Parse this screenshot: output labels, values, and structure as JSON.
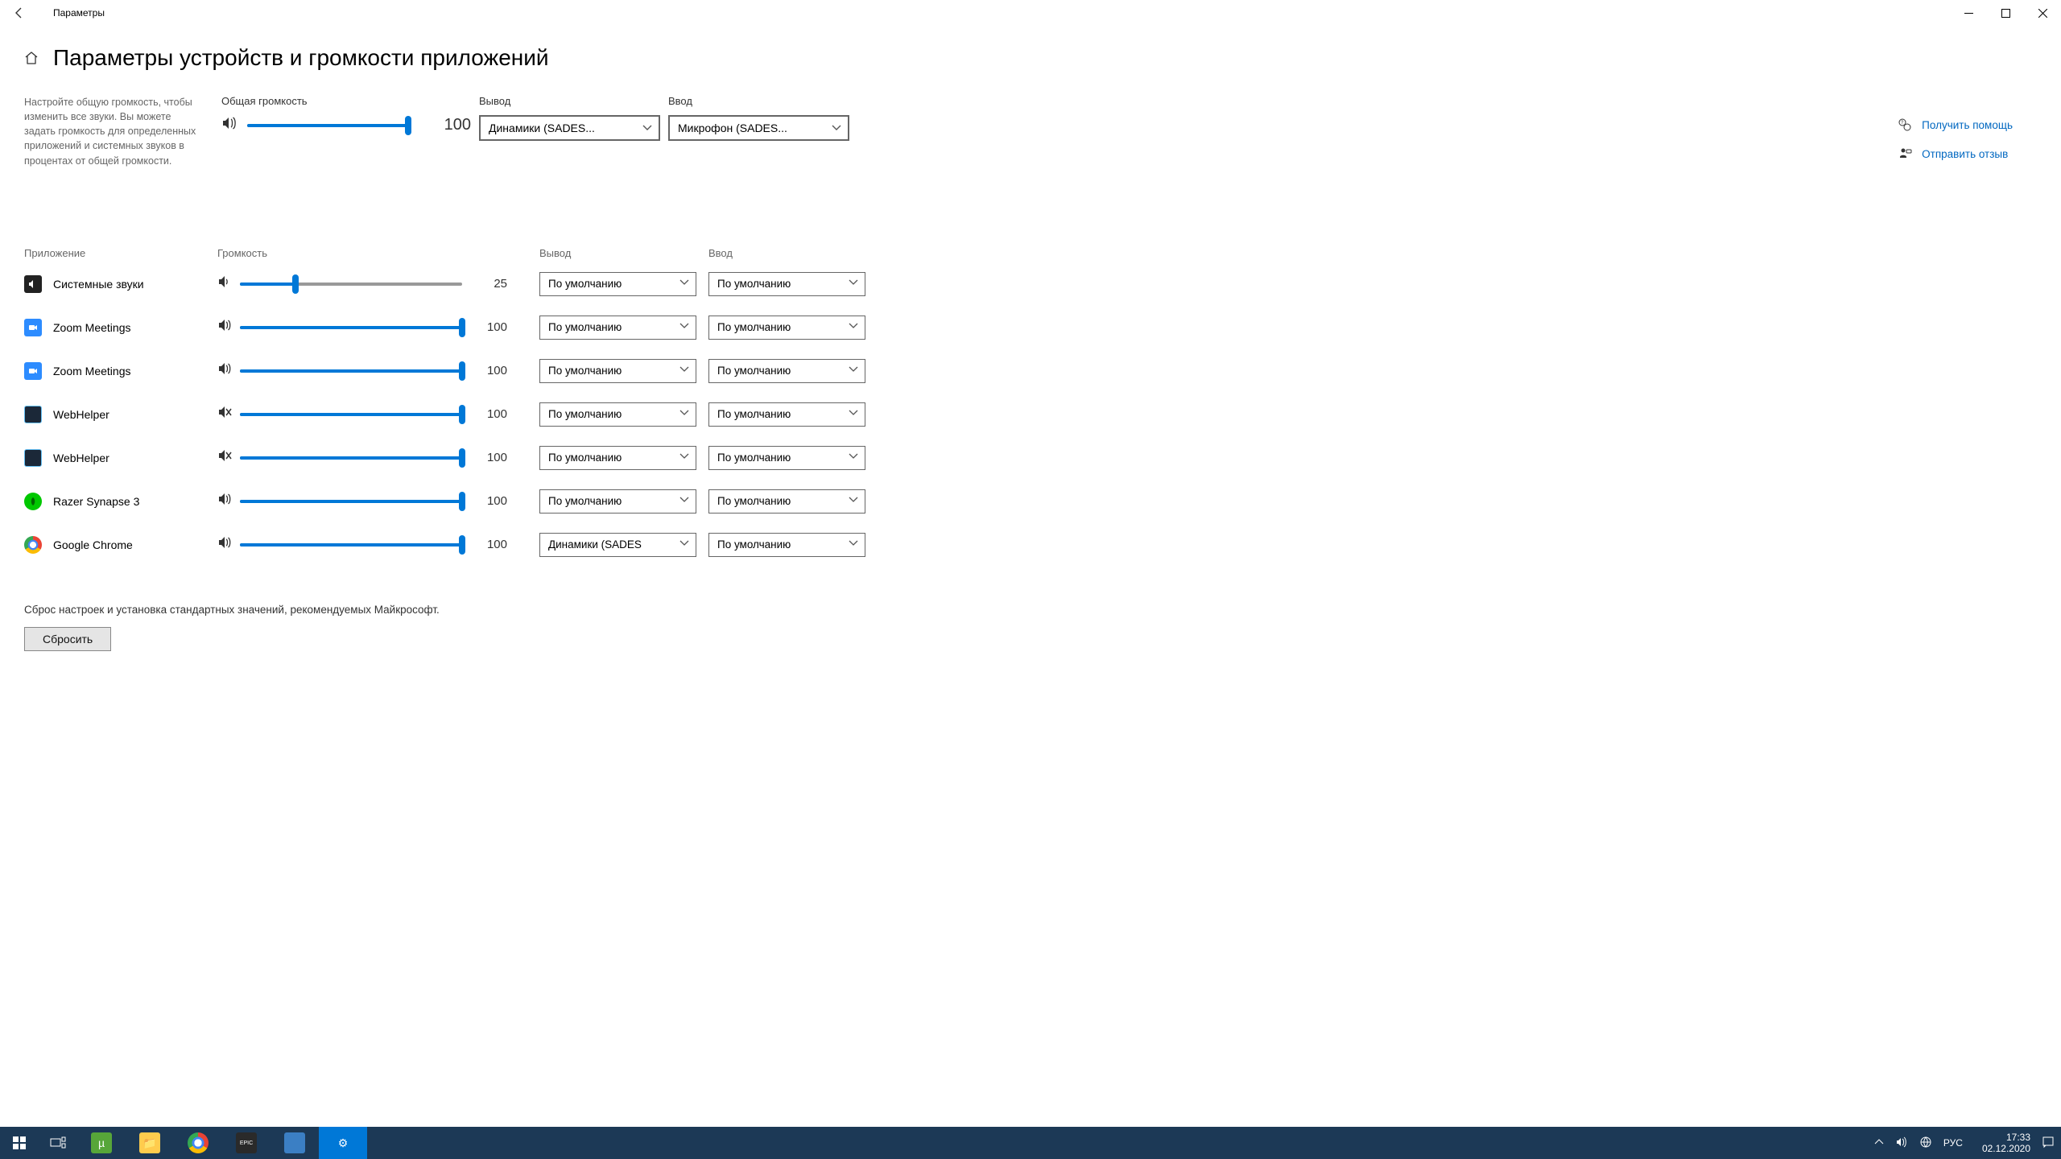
{
  "window": {
    "title": "Параметры"
  },
  "page_title": "Параметры устройств и громкости приложений",
  "description": "Настройте общую громкость, чтобы изменить все звуки. Вы можете задать громкость для определенных приложений и системных звуков в процентах от общей громкости.",
  "master": {
    "label": "Общая громкость",
    "value": "100",
    "pct": 100,
    "output_label": "Вывод",
    "output_value": "Динамики (SADES...",
    "input_label": "Ввод",
    "input_value": "Микрофон (SADES..."
  },
  "side": {
    "help": "Получить помощь",
    "feedback": "Отправить отзыв"
  },
  "apps_header": {
    "app": "Приложение",
    "vol": "Громкость",
    "out": "Вывод",
    "in": "Ввод"
  },
  "apps": [
    {
      "name": "Системные звуки",
      "vol": "25",
      "pct": 25,
      "out": "По умолчанию",
      "in": "По умолчанию",
      "icon": "sys",
      "muted": false,
      "low": true
    },
    {
      "name": "Zoom Meetings",
      "vol": "100",
      "pct": 100,
      "out": "По умолчанию",
      "in": "По умолчанию",
      "icon": "zoom",
      "muted": false
    },
    {
      "name": "Zoom Meetings",
      "vol": "100",
      "pct": 100,
      "out": "По умолчанию",
      "in": "По умолчанию",
      "icon": "zoom",
      "muted": false
    },
    {
      "name": "WebHelper",
      "vol": "100",
      "pct": 100,
      "out": "По умолчанию",
      "in": "По умолчанию",
      "icon": "steam",
      "muted": true
    },
    {
      "name": "WebHelper",
      "vol": "100",
      "pct": 100,
      "out": "По умолчанию",
      "in": "По умолчанию",
      "icon": "steam",
      "muted": true
    },
    {
      "name": "Razer Synapse 3",
      "vol": "100",
      "pct": 100,
      "out": "По умолчанию",
      "in": "По умолчанию",
      "icon": "razer",
      "muted": false
    },
    {
      "name": "Google Chrome",
      "vol": "100",
      "pct": 100,
      "out": "Динамики (SADES",
      "in": "По умолчанию",
      "icon": "chrome",
      "muted": false
    }
  ],
  "reset": {
    "desc": "Сброс настроек и установка стандартных значений, рекомендуемых Майкрософт.",
    "button": "Сбросить"
  },
  "taskbar": {
    "lang": "РУС",
    "time": "17:33",
    "date": "02.12.2020"
  }
}
